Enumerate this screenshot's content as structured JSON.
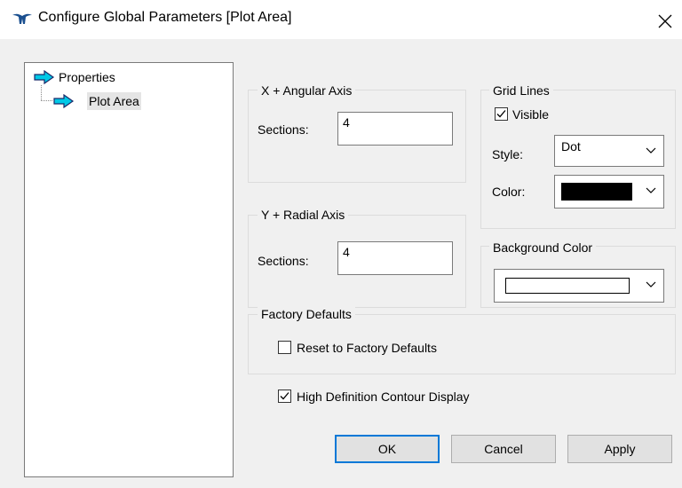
{
  "window": {
    "title": "Configure Global Parameters [Plot Area]",
    "close_glyph": "✕"
  },
  "tree": {
    "root_label": "Properties",
    "child_label": "Plot Area",
    "arrow_color": "#00c8e6"
  },
  "x_axis": {
    "group_label": "X + Angular Axis",
    "sections_label": "Sections:",
    "sections_value": "4"
  },
  "y_axis": {
    "group_label": "Y + Radial Axis",
    "sections_label": "Sections:",
    "sections_value": "4"
  },
  "grid_lines": {
    "group_label": "Grid Lines",
    "visible_label": "Visible",
    "visible_checked": true,
    "style_label": "Style:",
    "style_value": "Dot",
    "color_label": "Color:",
    "color_value": "#000000"
  },
  "background_color": {
    "group_label": "Background Color",
    "color_value": "#ffffff"
  },
  "factory_defaults": {
    "group_label": "Factory Defaults",
    "reset_label": "Reset to Factory Defaults",
    "reset_checked": false
  },
  "hd_contour": {
    "label": "High Definition Contour Display",
    "checked": true
  },
  "buttons": {
    "ok": "OK",
    "cancel": "Cancel",
    "apply": "Apply"
  }
}
